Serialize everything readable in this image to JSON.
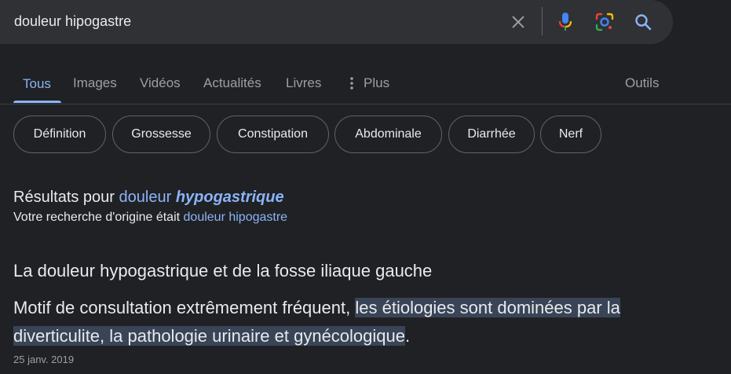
{
  "search": {
    "query": "douleur hipogastre",
    "icons": [
      "close-icon",
      "microphone-icon",
      "google-lens-icon",
      "search-icon"
    ]
  },
  "tabs": [
    {
      "label": "Tous",
      "active": true
    },
    {
      "label": "Images"
    },
    {
      "label": "Vidéos"
    },
    {
      "label": "Actualités"
    },
    {
      "label": "Livres"
    },
    {
      "label": "Plus"
    }
  ],
  "tools_label": "Outils",
  "chips": [
    "Définition",
    "Grossesse",
    "Constipation",
    "Abdominale",
    "Diarrhée",
    "Nerf"
  ],
  "correction": {
    "prefix": "Résultats pour",
    "corrected_plain": "douleur",
    "corrected_bold": "hypogastrique",
    "original_prefix": "Votre recherche d'origine était",
    "original_query": "douleur hipogastre"
  },
  "snippet": {
    "title": "La douleur hypogastrique et de la fosse iliaque gauche",
    "text_plain": "Motif de consultation extrêmement fréquent,",
    "text_highlight": "les étiologies sont dominées par la diverticulite, la pathologie urinaire et gynécologique",
    "text_end": ".",
    "date": "25 janv. 2019"
  },
  "colors": {
    "background": "#202124",
    "search_bar": "#303134",
    "accent_link": "#8ab4f8",
    "highlight": "#394457",
    "muted": "#9aa0a6"
  }
}
